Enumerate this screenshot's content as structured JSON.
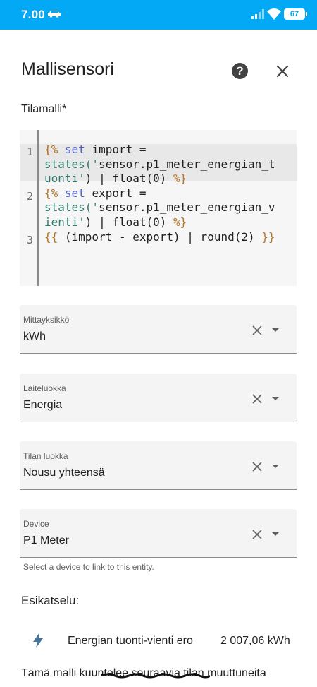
{
  "status_bar": {
    "time": "7.00",
    "battery": "67",
    "icons": [
      "car-icon",
      "signal-icon",
      "wifi-icon",
      "battery-icon"
    ]
  },
  "dialog": {
    "title": "Mallisensori",
    "icons": [
      "help-icon",
      "close-icon"
    ]
  },
  "template": {
    "label": "Tilamalli*",
    "line_numbers": [
      "1",
      "2",
      "3"
    ],
    "lines": [
      "{% set import = states('sensor.p1_meter_energian_tuonti') | float(0) %}",
      "{% set export = states('sensor.p1_meter_energian_vienti') | float(0) %}",
      "{{ (import - export) | round(2) }}"
    ]
  },
  "fields": [
    {
      "label": "Mittayksikkö",
      "value": "kWh"
    },
    {
      "label": "Laiteluokka",
      "value": "Energia"
    },
    {
      "label": "Tilan luokka",
      "value": "Nousu yhteensä"
    },
    {
      "label": "Device",
      "value": "P1 Meter",
      "helper": "Select a device to link to this entity."
    }
  ],
  "preview": {
    "label": "Esikatselu:",
    "icon": "lightning-bolt-icon",
    "entity_name": "Energian tuonti-vienti ero",
    "state": "2 007,06 kWh"
  },
  "footer": {
    "text": "Tämä malli kuuntelee seuraavia tilan muuttuneita"
  },
  "colors": {
    "status_bar": "#03a9f4",
    "icon_accent": "#44739e"
  }
}
